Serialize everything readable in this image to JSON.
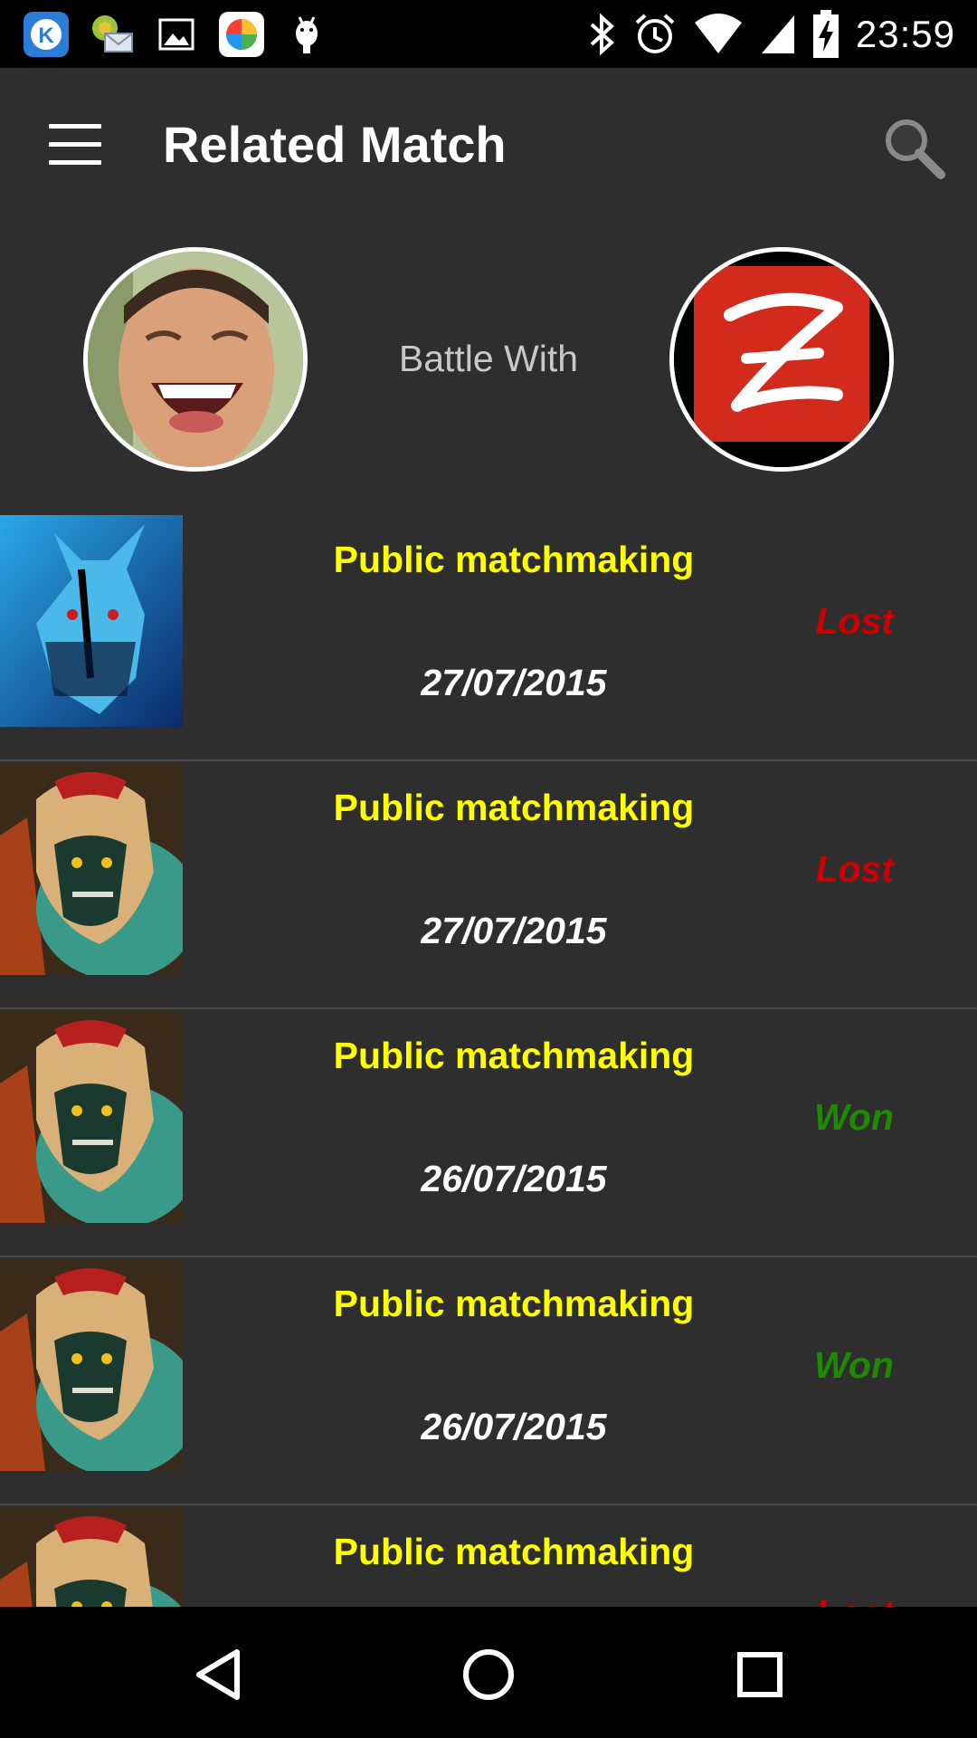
{
  "status_bar": {
    "time": "23:59",
    "left_icons": [
      "k-app-icon",
      "mail-icon",
      "gallery-icon",
      "browser-icon",
      "android-icon"
    ],
    "right_icons": [
      "bluetooth-icon",
      "alarm-icon",
      "wifi-icon",
      "signal-icon",
      "battery-charging-icon"
    ]
  },
  "app_bar": {
    "title": "Related Match"
  },
  "battle": {
    "label": "Battle With"
  },
  "matches": [
    {
      "type": "Public matchmaking",
      "result": "Lost",
      "date": "27/07/2015",
      "hero": "blue-hero"
    },
    {
      "type": "Public matchmaking",
      "result": "Lost",
      "date": "27/07/2015",
      "hero": "hooded-hero"
    },
    {
      "type": "Public matchmaking",
      "result": "Won",
      "date": "26/07/2015",
      "hero": "hooded-hero"
    },
    {
      "type": "Public matchmaking",
      "result": "Won",
      "date": "26/07/2015",
      "hero": "hooded-hero"
    },
    {
      "type": "Public matchmaking",
      "result": "Lost",
      "date": "",
      "hero": "hooded-hero"
    }
  ],
  "colors": {
    "background": "#2e2e2e",
    "match_type": "#ffff00",
    "lost": "#cc0000",
    "won": "#1e8a00",
    "date": "#ffffff"
  }
}
